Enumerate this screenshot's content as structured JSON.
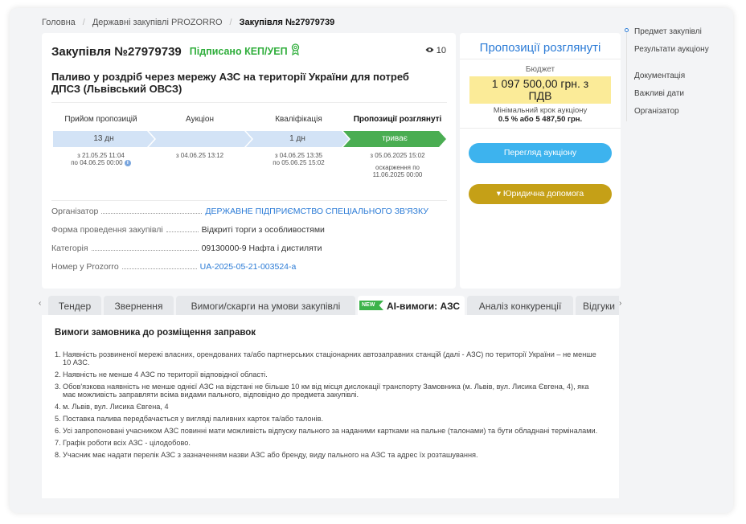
{
  "breadcrumb": {
    "home": "Головна",
    "section": "Державні закупівлі PROZORRO",
    "current": "Закупівля №27979739"
  },
  "tender": {
    "title": "Закупівля №27979739",
    "signed": "Підписано КЕП/УЕП",
    "views": "10",
    "subject": "Паливо у роздріб через мережу АЗС на території України для потреб ДПСЗ (Львівський ОВСЗ)"
  },
  "stages": [
    {
      "label": "Прийом пропозицій",
      "arrow": "13 дн",
      "date1": "з 21.05.25 11:04",
      "date2": "по 04.06.25 00:00",
      "info": "i"
    },
    {
      "label": "Аукціон",
      "arrow": "",
      "date1": "з 04.06.25 13:12",
      "date2": ""
    },
    {
      "label": "Кваліфікація",
      "arrow": "1 дн",
      "date1": "з 04.06.25 13:35",
      "date2": "по 05.06.25 15:02"
    },
    {
      "label": "Пропозиції розглянуті",
      "arrow": "триває",
      "date1": "з 05.06.2025 15:02",
      "date2": "оскарження по",
      "date3": "11.06.2025 00:00"
    }
  ],
  "props": [
    {
      "key": "Організатор",
      "value": "ДЕРЖАВНЕ ПІДПРИЄМСТВО СПЕЦІАЛЬНОГО ЗВ'ЯЗКУ"
    },
    {
      "key": "Форма проведення закупівлі",
      "value": "Відкриті торги з особливостями"
    },
    {
      "key": "Категорія",
      "value": "09130000-9 Нафта і дистиляти"
    },
    {
      "key": "Номер у Prozorro",
      "value": "UA-2025-05-21-003524-a"
    }
  ],
  "side": {
    "status": "Пропозиції розглянуті",
    "budget_label": "Бюджет",
    "budget_line1": "1 097 500,00 грн. з",
    "budget_line2": "ПДВ",
    "min_step_label": "Мінімальний крок аукціону",
    "min_step_value": "0.5 % або 5 487,50 грн.",
    "auction_button": "Перегляд аукціону",
    "legal_button": "▾ Юридична допомога"
  },
  "right_nav": [
    "Предмет закупівлі",
    "Результати аукціону",
    "Документація",
    "Важливі дати",
    "Організатор"
  ],
  "tabs": [
    "Тендер",
    "Звернення",
    "Вимоги/скарги на умови закупівлі",
    "AI-вимоги: АЗС",
    "Аналіз конкуренції",
    "Відгуки"
  ],
  "new_badge": "NEW",
  "tab_prev": "‹",
  "tab_next": "›",
  "content": {
    "title": "Вимоги замовника до розміщення заправок",
    "items": [
      {
        "num": "1.",
        "text": "Наявність розвиненої мережі власних, орендованих та/або партнерських стаціонарних автозаправних станцій (далі - АЗС) по території України – не менше 10 АЗС."
      },
      {
        "num": "2.",
        "text": "Наявність не менше 4 АЗС по території відповідної області."
      },
      {
        "num": "3.",
        "text": "Обов'язкова наявність не менше однієї АЗС на відстані не більше 10 км від місця дислокації транспорту Замовника (м. Львів, вул. Лисика Євгена, 4), яка має можливість заправляти всіма видами пального, відповідно до предмета закупівлі."
      },
      {
        "num": "4.",
        "text": "м. Львів, вул. Лисика Євгена, 4"
      },
      {
        "num": "5.",
        "text": "Поставка палива передбачається у вигляді паливних карток та/або талонів."
      },
      {
        "num": "6.",
        "text": "Усі запропоновані учасником АЗС повинні мати можливість відпуску пального за наданими картками на пальне (талонами) та бути обладнані терміналами."
      },
      {
        "num": "7.",
        "text": "Графік роботи всіх АЗС - цілодобово."
      },
      {
        "num": "8.",
        "text": "Учасник має надати перелік АЗС з зазначенням назви АЗС або бренду, виду пального на АЗС та адрес їх розташування."
      }
    ]
  },
  "colors": {
    "accent_blue": "#2b7bd6",
    "signed_green": "#2fae3b",
    "stage_active": "#4aad52",
    "stage_inactive": "#d3e3f6",
    "budget_bg": "#fbeb98",
    "auction_button": "#3db3ee",
    "legal_button": "#c5a017"
  }
}
